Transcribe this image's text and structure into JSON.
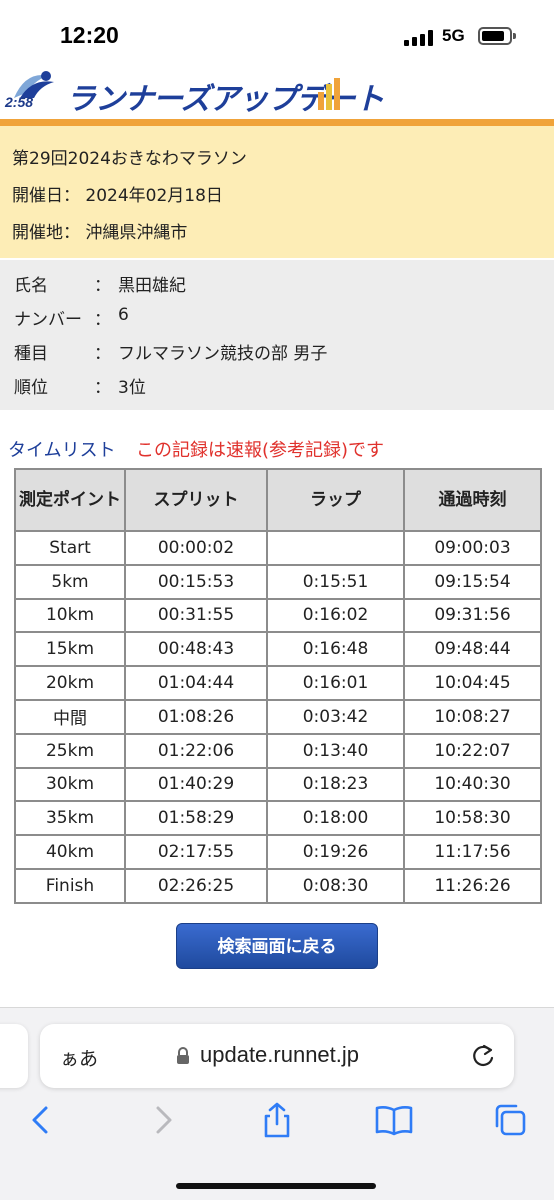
{
  "status_bar": {
    "time": "12:20",
    "network": "5G"
  },
  "logo": {
    "time_text": "2:58",
    "text": "ランナーズアップデート"
  },
  "event": {
    "name": "第29回2024おきなわマラソン",
    "date_label": "開催日：",
    "date": "2024年02月18日",
    "venue_label": "開催地：",
    "venue": "沖縄県沖縄市"
  },
  "runner": {
    "rows": [
      {
        "label": "氏名",
        "sep": "：",
        "value": "黒田雄紀"
      },
      {
        "label": "ナンバー",
        "sep": "：",
        "value": "6"
      },
      {
        "label": "種目",
        "sep": "：",
        "value": "フルマラソン競技の部 男子"
      },
      {
        "label": "順位",
        "sep": "：",
        "value": "3位"
      }
    ]
  },
  "time_list": {
    "title": "タイムリスト",
    "note": "この記録は速報(参考記録)です",
    "headers": [
      "測定ポイント",
      "スプリット",
      "ラップ",
      "通過時刻"
    ],
    "rows": [
      [
        "Start",
        "00:00:02",
        "",
        "09:00:03"
      ],
      [
        "5km",
        "00:15:53",
        "0:15:51",
        "09:15:54"
      ],
      [
        "10km",
        "00:31:55",
        "0:16:02",
        "09:31:56"
      ],
      [
        "15km",
        "00:48:43",
        "0:16:48",
        "09:48:44"
      ],
      [
        "20km",
        "01:04:44",
        "0:16:01",
        "10:04:45"
      ],
      [
        "中間",
        "01:08:26",
        "0:03:42",
        "10:08:27"
      ],
      [
        "25km",
        "01:22:06",
        "0:13:40",
        "10:22:07"
      ],
      [
        "30km",
        "01:40:29",
        "0:18:23",
        "10:40:30"
      ],
      [
        "35km",
        "01:58:29",
        "0:18:00",
        "10:58:30"
      ],
      [
        "40km",
        "02:17:55",
        "0:19:26",
        "11:17:56"
      ],
      [
        "Finish",
        "02:26:25",
        "0:08:30",
        "11:26:26"
      ]
    ]
  },
  "back_button": {
    "label": "検索画面に戻る"
  },
  "browser": {
    "aa_label": "ぁあ",
    "url": "update.runnet.jp"
  },
  "colors": {
    "brand_blue": "#1e3f9a",
    "orange": "#f0a33a",
    "event_bg": "#fdedb6",
    "note_red": "#e0312c",
    "ios_blue": "#2f7cf6"
  },
  "icons": [
    "lock-icon",
    "reload-icon",
    "back-arrow-icon",
    "forward-arrow-icon",
    "share-icon",
    "bookmarks-icon",
    "tabs-icon"
  ]
}
